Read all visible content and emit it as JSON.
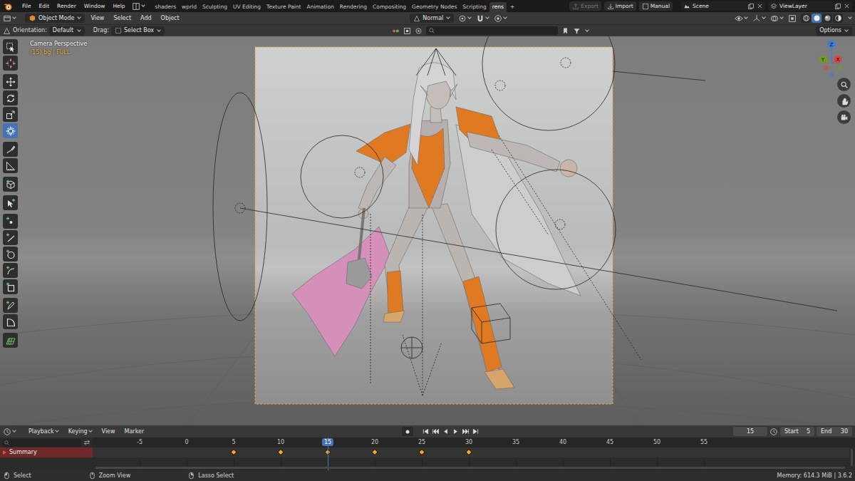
{
  "top_bar": {
    "menus": [
      "File",
      "Edit",
      "Render",
      "Window",
      "Help"
    ],
    "workspaces": [
      {
        "label": "shaders",
        "selected": false
      },
      {
        "label": "wprld",
        "selected": false
      },
      {
        "label": "Sculpting",
        "selected": false
      },
      {
        "label": "UV Editing",
        "selected": false
      },
      {
        "label": "Texture Paint",
        "selected": false
      },
      {
        "label": "Animation",
        "selected": false
      },
      {
        "label": "Rendering",
        "selected": false
      },
      {
        "label": "Compositing",
        "selected": false
      },
      {
        "label": "Geometry Nodes",
        "selected": false
      },
      {
        "label": "Scripting",
        "selected": false
      },
      {
        "label": "rens",
        "selected": true
      }
    ],
    "add_workspace": "+",
    "buttons": [
      {
        "label": "Export",
        "disabled": true
      },
      {
        "label": "Import",
        "disabled": false
      },
      {
        "label": "Manual",
        "disabled": false
      }
    ],
    "scene": "Scene",
    "view_layer": "ViewLayer"
  },
  "header": {
    "mode": "Object Mode",
    "menus": [
      "View",
      "Select",
      "Add",
      "Object"
    ],
    "transform_orientation": "Normal",
    "shading_modes": [
      {
        "kind": "wireframe",
        "selected": false
      },
      {
        "kind": "solid",
        "selected": true
      },
      {
        "kind": "material",
        "selected": false
      },
      {
        "kind": "rendered",
        "selected": false
      }
    ]
  },
  "tool_settings": {
    "orientation_label": "Orientation:",
    "orientation": "Default",
    "drag_label": "Drag:",
    "drag": "Select Box",
    "options": "Options"
  },
  "toolbar": [
    {
      "kind": "select",
      "selected": false
    },
    {
      "kind": "cursor",
      "selected": false
    },
    {
      "kind": "move",
      "selected": false
    },
    {
      "kind": "rotate",
      "selected": false
    },
    {
      "kind": "scale",
      "selected": false
    },
    {
      "kind": "transform",
      "selected": true
    },
    {
      "kind": "annotate",
      "selected": false
    },
    {
      "kind": "measure",
      "selected": false
    },
    {
      "kind": "addcube",
      "selected": false
    },
    {
      "kind": "arrowadd",
      "selected": false
    },
    {
      "kind": "point",
      "selected": false
    },
    {
      "kind": "line",
      "selected": false
    },
    {
      "kind": "circle",
      "selected": false
    },
    {
      "kind": "arc",
      "selected": false
    },
    {
      "kind": "rect",
      "selected": false
    },
    {
      "kind": "pen",
      "selected": false
    },
    {
      "kind": "corner",
      "selected": false
    },
    {
      "kind": "grid",
      "selected": false
    }
  ],
  "viewport": {
    "view_name": "Camera Perspective",
    "object_info": "(15) bg | FULL",
    "gizmo_axes": [
      {
        "label": "X",
        "color": "#d8443f"
      },
      {
        "label": "Y",
        "color": "#6f9a28"
      },
      {
        "label": "Z",
        "color": "#3d7ed4"
      }
    ]
  },
  "timeline": {
    "menus": [
      "Playback",
      "Keying",
      "View",
      "Marker"
    ],
    "current_frame": "15",
    "start_label": "Start",
    "start": "5",
    "end_label": "End",
    "end": "30",
    "ruler": [
      "-5",
      "0",
      "5",
      "10",
      "15",
      "20",
      "25",
      "30",
      "35",
      "40",
      "45",
      "50",
      "55"
    ],
    "playhead": "15",
    "channels": [
      {
        "name": "Summary",
        "expanded": false,
        "keyframes": [
          {
            "frame": 5,
            "selected": true
          },
          {
            "frame": 10,
            "selected": true
          },
          {
            "frame": 15,
            "selected": true
          },
          {
            "frame": 20,
            "selected": true
          },
          {
            "frame": 25,
            "selected": true
          },
          {
            "frame": 30,
            "selected": true
          }
        ]
      }
    ]
  },
  "status_bar": {
    "hints": [
      "Select",
      "Zoom View",
      "Lasso Select"
    ],
    "info": "Memory: 614.3 MiB | 3.6.2"
  }
}
